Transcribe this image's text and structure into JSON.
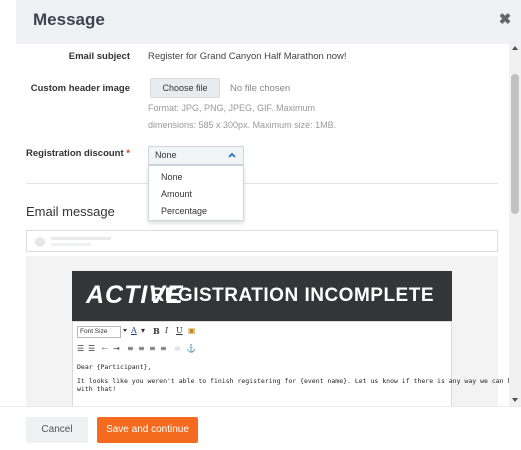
{
  "header": {
    "title": "Message",
    "close_icon": "close-icon"
  },
  "form": {
    "email_subject_label": "Email subject",
    "email_subject_value": "Register for Grand Canyon Half Marathon now!",
    "custom_header_label": "Custom header image",
    "choose_file_label": "Choose file",
    "no_file_text": "No file chosen",
    "hint_line1": "Format: JPG, PNG, JPEG, GIF. Maximum",
    "hint_line2": "dimensions: 585 x 300px. Maximum size: 1MB.",
    "registration_discount_label": "Registration discount",
    "required_marker": "*",
    "discount_selected": "None",
    "discount_options": [
      "None",
      "Amount",
      "Percentage"
    ]
  },
  "email_message": {
    "title": "Email message"
  },
  "banner": {
    "logo": "ACTIVE",
    "title": "REGISTRATION INCOMPLETE",
    "background_color": "#333537"
  },
  "rte": {
    "font_size_label": "Font Size",
    "text_line1": "Dear {Participant},",
    "text_line2": "It looks like you weren't able to finish registering for {event name}. Let us know if there is any way we can help",
    "text_line3": "with that!"
  },
  "footer": {
    "cancel_label": "Cancel",
    "save_label": "Save and continue",
    "save_color": "#f46b1f"
  }
}
